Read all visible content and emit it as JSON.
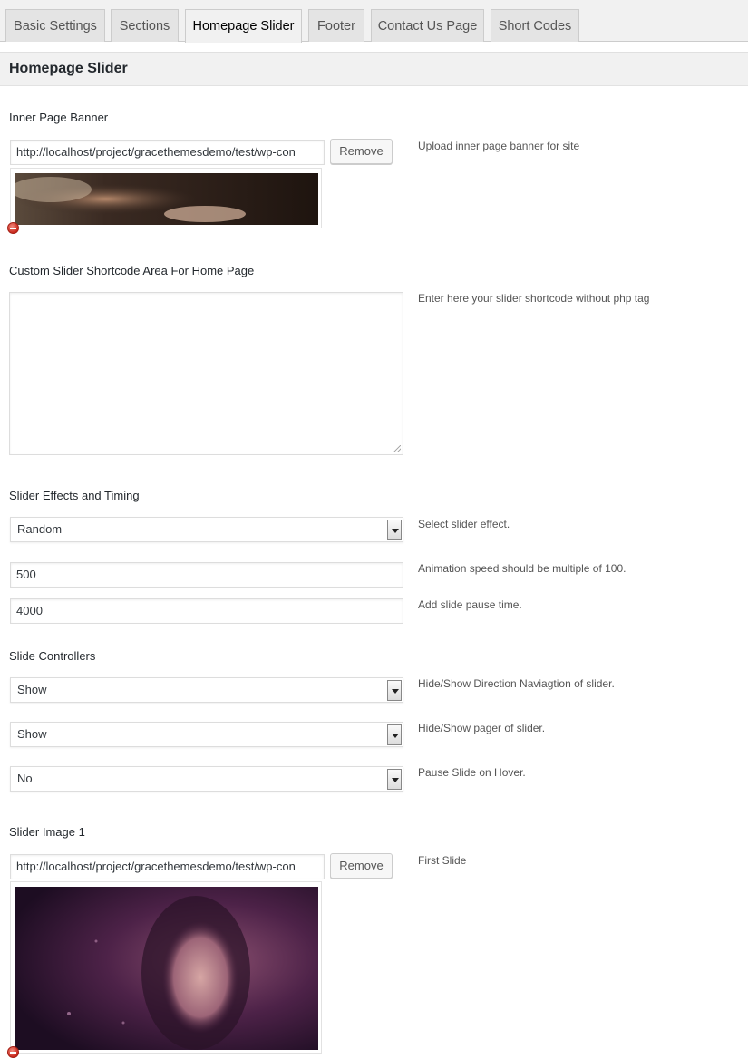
{
  "tabs": [
    {
      "label": "Basic Settings",
      "active": false
    },
    {
      "label": "Sections",
      "active": false
    },
    {
      "label": "Homepage Slider",
      "active": true
    },
    {
      "label": "Footer",
      "active": false
    },
    {
      "label": "Contact Us Page",
      "active": false
    },
    {
      "label": "Short Codes",
      "active": false
    }
  ],
  "page_title": "Homepage Slider",
  "inner_banner": {
    "title": "Inner Page Banner",
    "url_value": "http://localhost/project/gracethemesdemo/test/wp-con",
    "remove_label": "Remove",
    "description": "Upload inner page banner for site"
  },
  "shortcode_area": {
    "title": "Custom Slider Shortcode Area For Home Page",
    "value": "",
    "description": "Enter here your slider shortcode without php tag"
  },
  "effects": {
    "title": "Slider Effects and Timing",
    "effect_value": "Random",
    "effect_description": "Select slider effect.",
    "speed_value": "500",
    "speed_description": "Animation speed should be multiple of 100.",
    "pause_value": "4000",
    "pause_description": "Add slide pause time."
  },
  "controllers": {
    "title": "Slide Controllers",
    "direction_value": "Show",
    "direction_description": "Hide/Show Direction Naviagtion of slider.",
    "pager_value": "Show",
    "pager_description": "Hide/Show pager of slider.",
    "hover_value": "No",
    "hover_description": "Pause Slide on Hover."
  },
  "slider_image_1": {
    "title": "Slider Image 1",
    "url_value": "http://localhost/project/gracethemesdemo/test/wp-con",
    "remove_label": "Remove",
    "description": "First Slide"
  },
  "colors": {
    "tab_bg": "#e4e4e4",
    "tab_active_bg": "#f1f1f1",
    "header_bg": "#f1f1f1",
    "remove_icon": "#c8281c"
  }
}
